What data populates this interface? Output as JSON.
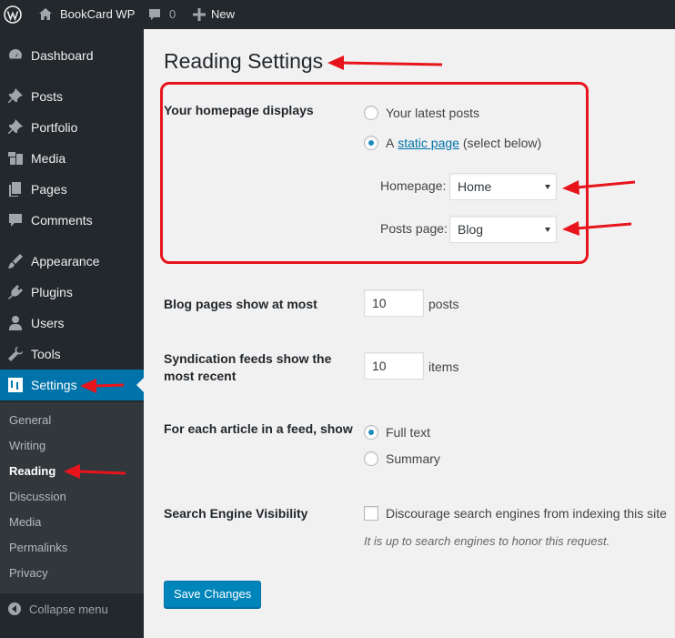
{
  "admin_bar": {
    "site_name": "BookCard WP",
    "comment_count": "0",
    "new_label": "New"
  },
  "sidebar": {
    "items": [
      {
        "label": "Dashboard",
        "icon": "dashboard-icon"
      },
      {
        "label": "Posts",
        "icon": "pin-icon"
      },
      {
        "label": "Portfolio",
        "icon": "pin-icon"
      },
      {
        "label": "Media",
        "icon": "media-icon"
      },
      {
        "label": "Pages",
        "icon": "pages-icon"
      },
      {
        "label": "Comments",
        "icon": "comment-icon"
      },
      {
        "label": "Appearance",
        "icon": "brush-icon"
      },
      {
        "label": "Plugins",
        "icon": "plugin-icon"
      },
      {
        "label": "Users",
        "icon": "user-icon"
      },
      {
        "label": "Tools",
        "icon": "wrench-icon"
      },
      {
        "label": "Settings",
        "icon": "settings-icon"
      }
    ],
    "submenu": [
      "General",
      "Writing",
      "Reading",
      "Discussion",
      "Media",
      "Permalinks",
      "Privacy"
    ],
    "current_submenu": "Reading",
    "collapse_label": "Collapse menu"
  },
  "page": {
    "title": "Reading Settings",
    "homepage_displays": {
      "label": "Your homepage displays",
      "option_latest": "Your latest posts",
      "option_static_prefix": "A",
      "option_static_link": "static page",
      "option_static_suffix": "(select below)",
      "selected": "static page",
      "homepage_label": "Homepage:",
      "homepage_value": "Home",
      "posts_page_label": "Posts page:",
      "posts_page_value": "Blog"
    },
    "blog_pages": {
      "label": "Blog pages show at most",
      "value": "10",
      "unit": "posts"
    },
    "syndication": {
      "label": "Syndication feeds show the most recent",
      "value": "10",
      "unit": "items"
    },
    "feed_article": {
      "label": "For each article in a feed, show",
      "option_full": "Full text",
      "option_summary": "Summary",
      "selected": "Full text"
    },
    "search_visibility": {
      "label": "Search Engine Visibility",
      "checkbox_label": "Discourage search engines from indexing this site",
      "checked": false,
      "description": "It is up to search engines to honor this request."
    },
    "save_button": "Save Changes"
  },
  "colors": {
    "admin_dark": "#23282d",
    "submenu_bg": "#32373c",
    "accent": "#0073aa",
    "button": "#0085ba",
    "annotation_red": "#e8141c"
  }
}
